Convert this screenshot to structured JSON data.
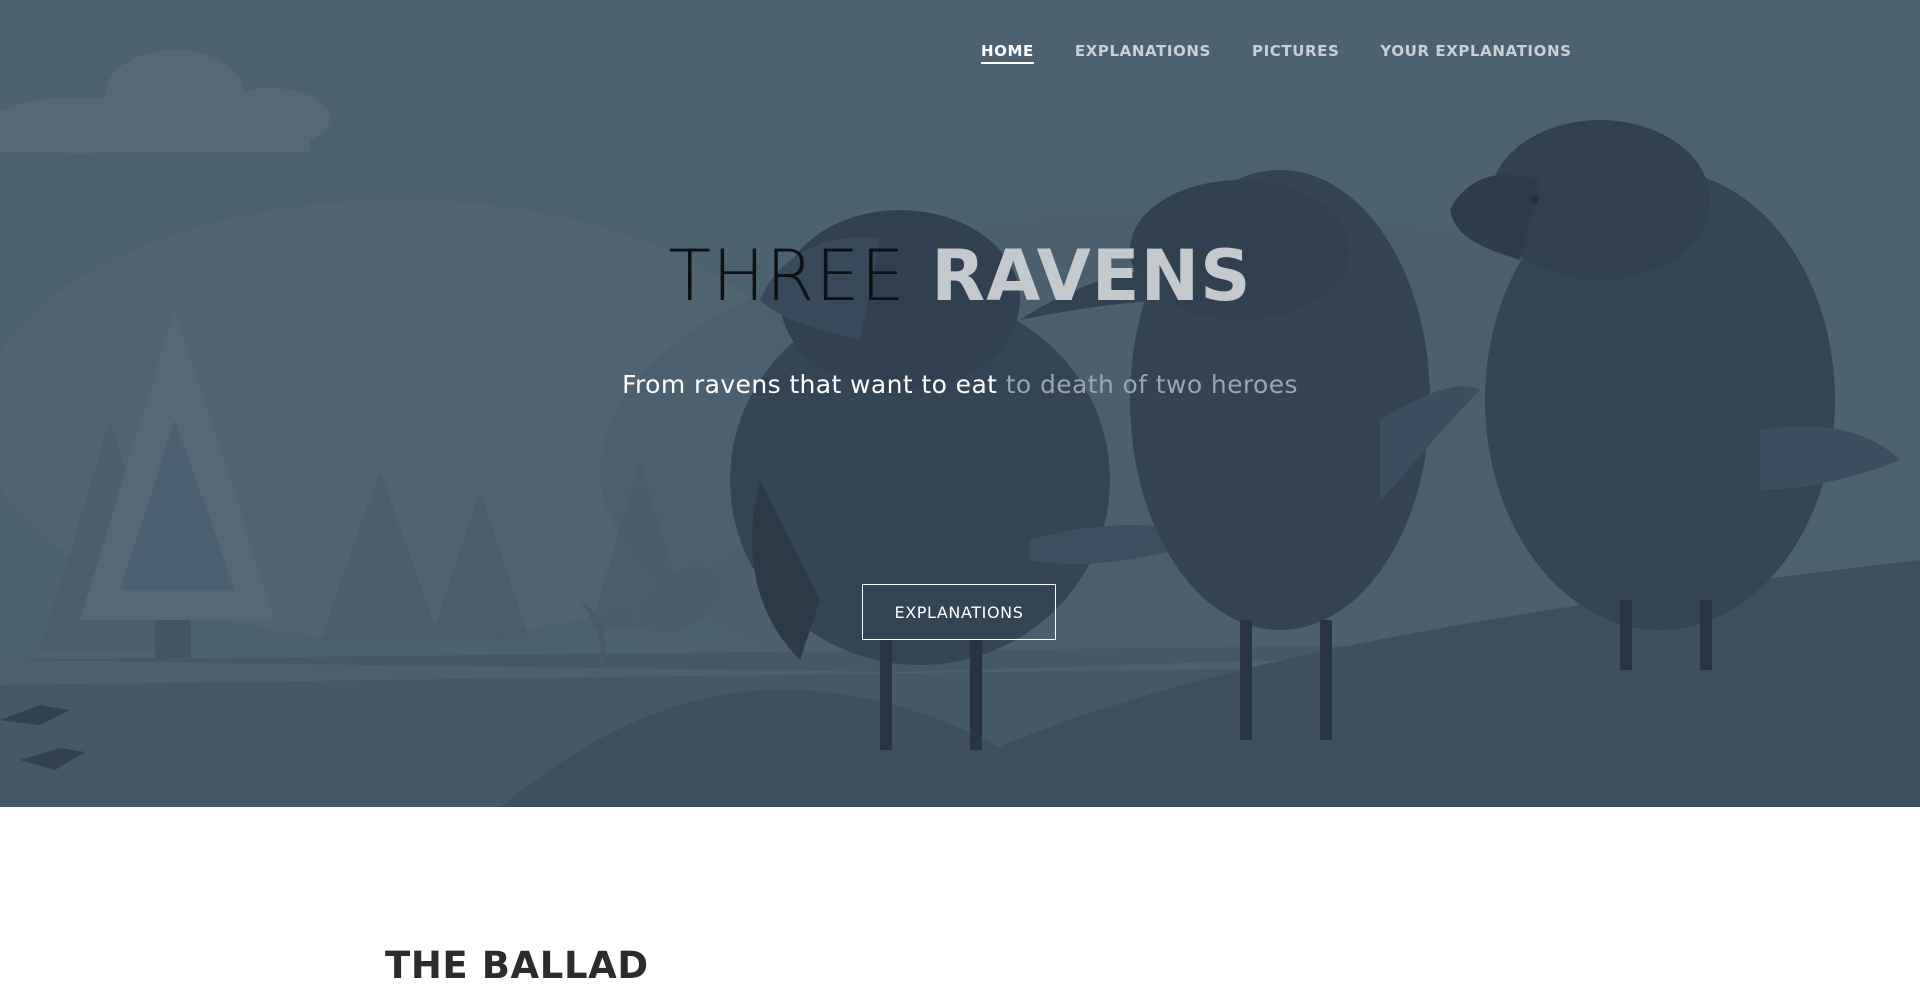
{
  "nav": {
    "items": [
      {
        "label": "HOME",
        "active": true
      },
      {
        "label": "EXPLANATIONS",
        "active": false
      },
      {
        "label": "PICTURES",
        "active": false
      },
      {
        "label": "YOUR EXPLANATIONS",
        "active": false
      }
    ]
  },
  "hero": {
    "title_light": "THREE",
    "title_bold": "RAVENS",
    "subtitle_highlight": "From ravens that want to eat",
    "subtitle_muted": "to death of two heroes",
    "cta_label": "EXPLANATIONS"
  },
  "section": {
    "title": "THE BALLAD"
  },
  "colors": {
    "hero_bg": "#536877",
    "raven_dark": "#2b3a4b",
    "text_muted": "#9aa5ad"
  }
}
